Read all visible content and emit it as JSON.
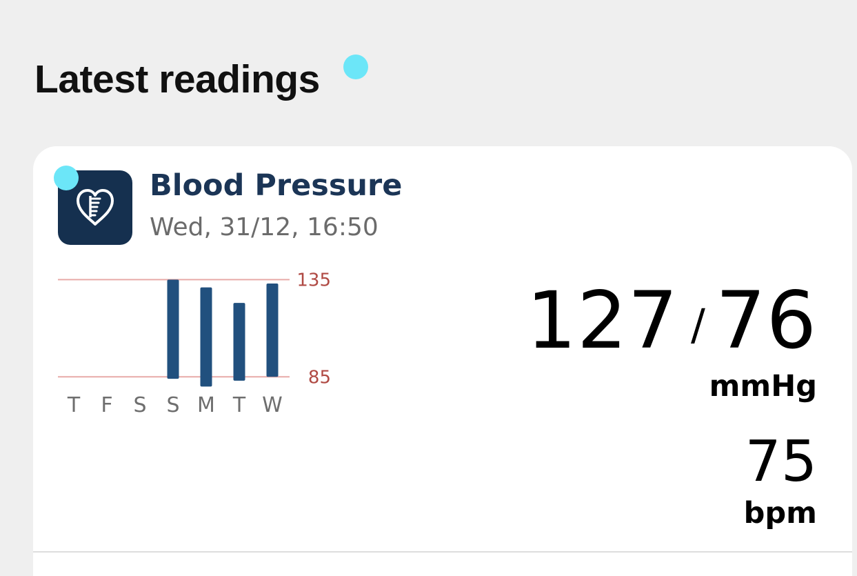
{
  "section": {
    "title": "Latest readings"
  },
  "card": {
    "icon": "heart-meter-icon",
    "title": "Blood Pressure",
    "timestamp": "Wed, 31/12, 16:50",
    "reading": {
      "systolic": "127",
      "separator": "/",
      "diastolic": "76",
      "pressure_unit": "mmHg",
      "pulse": "75",
      "pulse_unit": "bpm"
    }
  },
  "colors": {
    "background": "#efefef",
    "card": "#ffffff",
    "icon_tile": "#15304f",
    "title_text": "#1b3556",
    "bar": "#21507e",
    "threshold_line": "#e8aaa8",
    "threshold_label": "#b04a44",
    "indicator_dot": "#6ce6f8"
  },
  "chart_data": {
    "type": "bar",
    "categories": [
      "T",
      "F",
      "S",
      "S",
      "M",
      "T",
      "W"
    ],
    "series": [
      {
        "low": [
          null,
          null,
          null,
          84,
          80,
          83,
          85
        ],
        "high": [
          null,
          null,
          null,
          135,
          131,
          123,
          133
        ]
      }
    ],
    "reference_lines": [
      {
        "value": 135,
        "label": "135"
      },
      {
        "value": 85,
        "label": "85"
      }
    ],
    "ylim": [
      78,
      144
    ],
    "grid": false
  }
}
